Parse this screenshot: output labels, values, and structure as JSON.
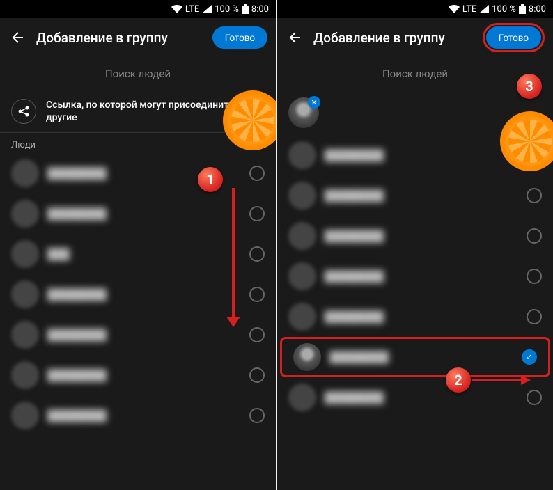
{
  "status": {
    "network": "LTE",
    "battery": "100 %",
    "time": "8:00"
  },
  "header": {
    "title": "Добавление в группу",
    "done_label": "Готово"
  },
  "search": {
    "placeholder": "Поиск людей"
  },
  "share_link": {
    "text": "Ссылка, по которой могут присоединиться другие"
  },
  "section": {
    "people_label": "Люди"
  },
  "contacts_left": [
    {
      "name": "████████",
      "selected": false
    },
    {
      "name": "████████",
      "selected": false
    },
    {
      "name": "███",
      "selected": false
    },
    {
      "name": "████████",
      "selected": false
    },
    {
      "name": "████████",
      "selected": false
    },
    {
      "name": "████████",
      "selected": false
    },
    {
      "name": "████████",
      "selected": false
    }
  ],
  "contacts_right": [
    {
      "name": "████████",
      "selected": false
    },
    {
      "name": "████████",
      "selected": false
    },
    {
      "name": "████████",
      "selected": false
    },
    {
      "name": "████████",
      "selected": false
    },
    {
      "name": "████████",
      "selected": false
    },
    {
      "name": "████████",
      "selected": true,
      "highlight": true
    },
    {
      "name": "████████",
      "selected": false
    }
  ],
  "steps": {
    "s1": "1",
    "s2": "2",
    "s3": "3"
  },
  "colors": {
    "accent": "#0078d4",
    "highlight": "#d62020"
  }
}
